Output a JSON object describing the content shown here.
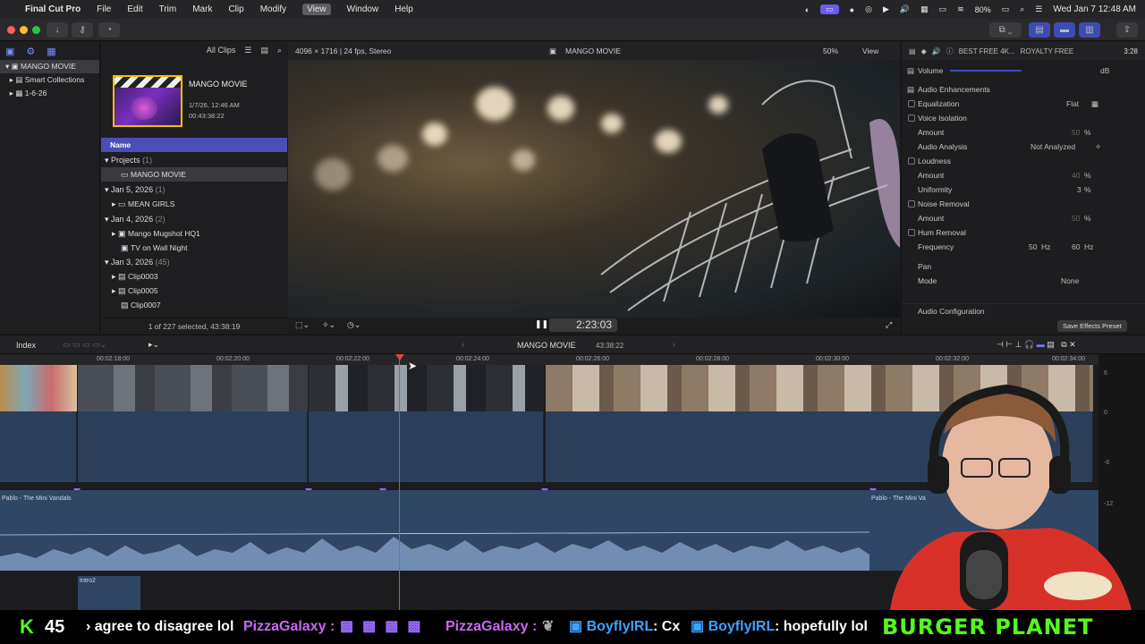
{
  "menubar": {
    "apple": "",
    "app": "Final Cut Pro",
    "items": [
      "File",
      "Edit",
      "Trim",
      "Mark",
      "Clip",
      "Modify",
      "View",
      "Window",
      "Help"
    ],
    "battery": "80%",
    "datetime": "Wed Jan 7  12:48 AM"
  },
  "library": {
    "items": [
      "MANGO MOVIE",
      "Smart Collections",
      "1-6-26"
    ]
  },
  "browser": {
    "filter": "All Clips",
    "project_title": "MANGO MOVIE",
    "project_date": "1/7/26, 12:46 AM",
    "project_duration": "00:43:38:22",
    "column_name": "Name",
    "rows": [
      {
        "label": "Projects",
        "count": "(1)"
      },
      {
        "label": "MANGO MOVIE",
        "count": ""
      },
      {
        "label": "Jan 5, 2026",
        "count": "(1)"
      },
      {
        "label": "MEAN GIRLS",
        "count": ""
      },
      {
        "label": "Jan 4, 2026",
        "count": "(2)"
      },
      {
        "label": "Mango Mugshot HQ1",
        "count": ""
      },
      {
        "label": "TV on Wall Night",
        "count": ""
      },
      {
        "label": "Jan 3, 2026",
        "count": "(45)"
      },
      {
        "label": "Clip0003",
        "count": ""
      },
      {
        "label": "Clip0005",
        "count": ""
      },
      {
        "label": "Clip0007",
        "count": ""
      }
    ],
    "footer": "1 of 227 selected, 43:38:19"
  },
  "viewer": {
    "format": "4096 × 1716 | 24 fps, Stereo",
    "title": "MANGO MOVIE",
    "zoom": "50%",
    "view": "View",
    "timecode": "2:23:03"
  },
  "inspector": {
    "clip_name": "BEST FREE 4K...",
    "clip_name2": "ROYALTY FREE",
    "duration": "3:28",
    "volume_label": "Volume",
    "volume_unit": "dB",
    "section": "Audio Enhancements",
    "rows": [
      {
        "label": "Equalization",
        "value": "Flat"
      },
      {
        "label": "Voice Isolation",
        "value": ""
      },
      {
        "label": "Amount",
        "value": "50",
        "unit": "%"
      },
      {
        "label": "Audio Analysis",
        "value": "Not Analyzed"
      },
      {
        "label": "Loudness",
        "value": ""
      },
      {
        "label": "Amount",
        "value": "40",
        "unit": "%"
      },
      {
        "label": "Uniformity",
        "value": "3",
        "unit": "%"
      },
      {
        "label": "Noise Removal",
        "value": ""
      },
      {
        "label": "Amount",
        "value": "50",
        "unit": "%"
      },
      {
        "label": "Hum Removal",
        "value": ""
      },
      {
        "label": "Frequency",
        "value": "50",
        "unit": "Hz",
        "value2": "60",
        "unit2": "Hz"
      }
    ],
    "pan_title": "Pan",
    "mode_label": "Mode",
    "mode_value": "None",
    "config_label": "Audio Configuration",
    "save_preset": "Save Effects Preset"
  },
  "timeline_bar": {
    "index": "Index",
    "project": "MANGO MOVIE",
    "duration": "43:38:22"
  },
  "timeline": {
    "ruler_labels": [
      "00:02:18:00",
      "00:02:20:00",
      "00:02:22:00",
      "00:02:24:00",
      "00:02:26:00",
      "00:02:28:00",
      "00:02:30:00",
      "00:02:32:00",
      "00:02:34:00"
    ],
    "music_label": "Pablo - The Mini Vandals",
    "music_label2": "Pablo - The Mini Va",
    "small_clip": "Intro2"
  },
  "meters": {
    "labels": [
      "6",
      "0",
      "-6",
      "-12"
    ]
  },
  "chat": {
    "count": "45",
    "msg1": "agree to disagree lol",
    "user1": "PizzaGalaxy",
    "user2": "PizzaGalaxy",
    "user3": "BoyflyIRL",
    "msg3": ": Cx",
    "user4": "BoyflyIRL",
    "msg4": ": hopefully lol",
    "brand": "BURGER PLANET"
  }
}
